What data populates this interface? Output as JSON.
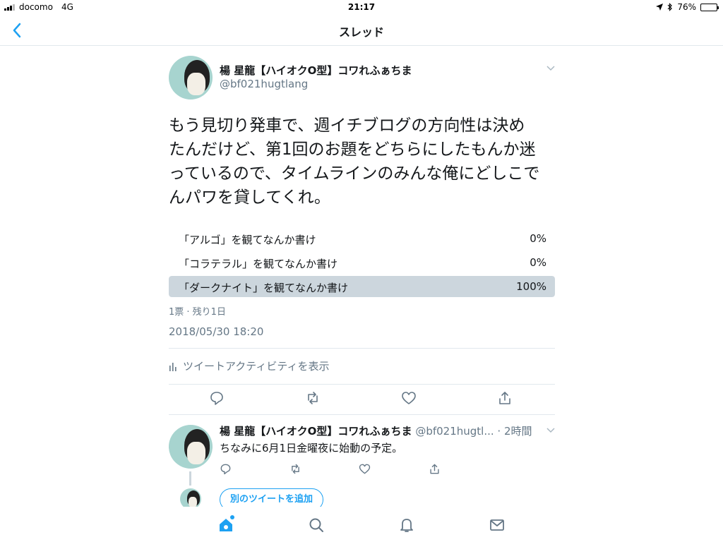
{
  "status_bar": {
    "carrier": "docomo",
    "network": "4G",
    "time": "21:17",
    "battery": "76%",
    "battery_level": 0.76
  },
  "nav": {
    "title": "スレッド",
    "back_icon": "chevron-left-icon"
  },
  "tweet": {
    "author_name": "楊 星龍【ハイオクO型】コワれふぁちま",
    "handle": "@bf021hugtlang",
    "text_lines": [
      "もう見切り発車で、週イチブログの方向性は決め",
      "たんだけど、第1回のお題をどちらにしたもんか迷",
      "っているので、タイムラインのみんな俺にどしこで",
      "んパワを貸してくれ。"
    ],
    "poll": {
      "options": [
        {
          "label": "「アルゴ」を観てなんか書け",
          "percent": "0%",
          "value": 0
        },
        {
          "label": "「コラテラル」を観てなんか書け",
          "percent": "0%",
          "value": 0
        },
        {
          "label": "「ダークナイト」を観てなんか書け",
          "percent": "100%",
          "value": 100
        }
      ],
      "meta": "1票 · 残り1日"
    },
    "timestamp": "2018/05/30 18:20",
    "activity_label": "ツイートアクティビティを表示",
    "actions": [
      "reply-icon",
      "retweet-icon",
      "like-icon",
      "share-icon"
    ]
  },
  "reply": {
    "author_name": "楊 星龍【ハイオクO型】コワれふぁちま",
    "handle_time": "@bf021hugtl... · 2時間",
    "text": "ちなみに6月1日金曜夜に始動の予定。",
    "add_button": "別のツイートを追加"
  },
  "tab_bar": {
    "items": [
      "home-icon",
      "search-icon",
      "notifications-icon",
      "messages-icon"
    ],
    "accent": "#1da1f2"
  },
  "colors": {
    "accent": "#1da1f2",
    "secondary_text": "#657786",
    "poll_bar": "#ccd6dd"
  }
}
